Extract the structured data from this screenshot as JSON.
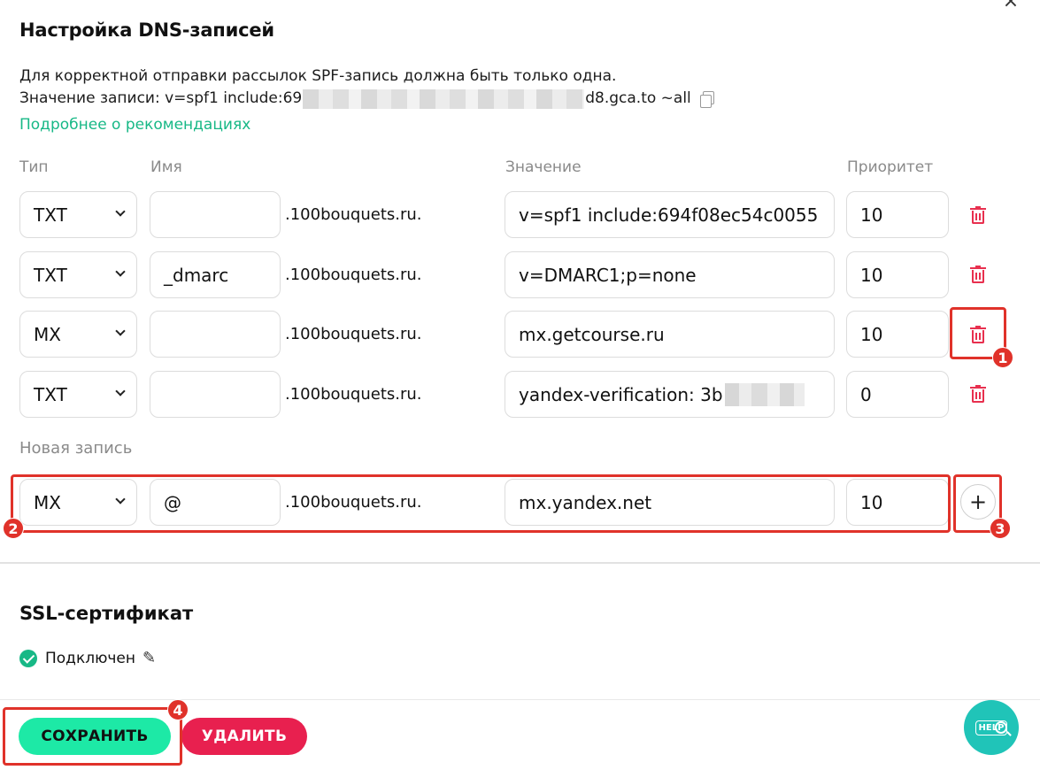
{
  "dialog": {
    "close_glyph": "×"
  },
  "dns": {
    "title": "Настройка DNS-записей",
    "info_line1": "Для корректной отправки рассылок SPF-запись должна быть только одна.",
    "info_line2_prefix": "Значение записи: v=spf1 include:69",
    "info_line2_suffix": "d8.gca.to ~all",
    "more_link": "Подробнее о рекомендациях",
    "columns": {
      "type": "Тип",
      "name": "Имя",
      "value": "Значение",
      "priority": "Приоритет"
    },
    "domain_suffix": ".100bouquets.ru.",
    "records": [
      {
        "type": "TXT",
        "name": "",
        "value": "v=spf1 include:694f08ec54c0055",
        "priority": "10"
      },
      {
        "type": "TXT",
        "name": "_dmarc",
        "value": "v=DMARC1;p=none",
        "priority": "10"
      },
      {
        "type": "MX",
        "name": "",
        "value": "mx.getcourse.ru",
        "priority": "10"
      },
      {
        "type": "TXT",
        "name": "",
        "value": "yandex-verification: 3b",
        "priority": "0"
      }
    ],
    "new_record_label": "Новая запись",
    "new_record": {
      "type": "MX",
      "name": "@",
      "value": "mx.yandex.net",
      "priority": "10"
    },
    "add_glyph": "+"
  },
  "ssl": {
    "title": "SSL-сертификат",
    "status": "Подключен"
  },
  "footer": {
    "save_label": "СОХРАНИТЬ",
    "delete_label": "УДАЛИТЬ",
    "help_label": "HELP"
  },
  "annotations": [
    "1",
    "2",
    "3",
    "4"
  ],
  "colors": {
    "accent_green": "#1de9a6",
    "link_green": "#17b886",
    "danger": "#e8204f",
    "annotation": "#e0322a",
    "help": "#20c4b8"
  }
}
